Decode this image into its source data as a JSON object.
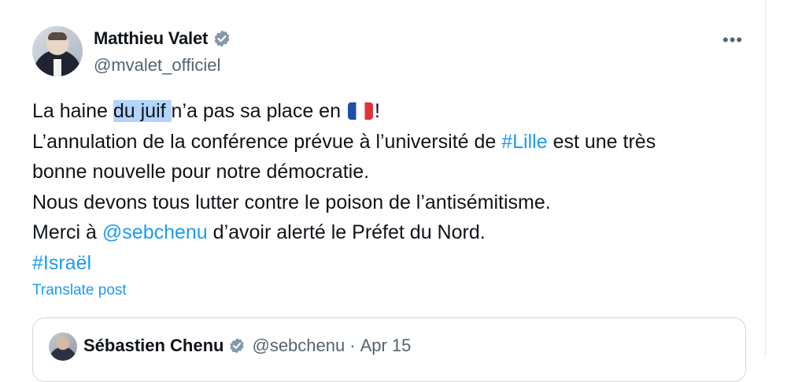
{
  "author": {
    "name": "Matthieu Valet",
    "handle": "@mvalet_officiel"
  },
  "more_icon": "more-horizontal-icon",
  "post": {
    "line1_a": "La haine ",
    "line1_highlight": "du juif ",
    "line1_b": "n’a pas sa place en ",
    "line1_flag": "french-flag-emoji",
    "line1_end": "!",
    "line2_a": "L’annulation de la conférence prévue à l’université de ",
    "line2_hashtag": "#Lille",
    "line2_b": " est une très",
    "line3": "bonne nouvelle pour notre démocratie.",
    "line4": "Nous devons tous lutter contre le poison de l’antisémitisme.",
    "line5_a": "Merci à ",
    "line5_mention": "@sebchenu",
    "line5_b": " d’avoir alerté le Préfet du Nord.",
    "line6_hashtag": "#Israël"
  },
  "translate_label": "Translate post",
  "quoted": {
    "name": "Sébastien Chenu",
    "handle": "@sebchenu",
    "separator": "·",
    "date": "Apr 15"
  },
  "colors": {
    "link": "#1d9bf0",
    "verified": "#829aab",
    "highlight": "#b3d4fc",
    "secondary_text": "#536471"
  }
}
